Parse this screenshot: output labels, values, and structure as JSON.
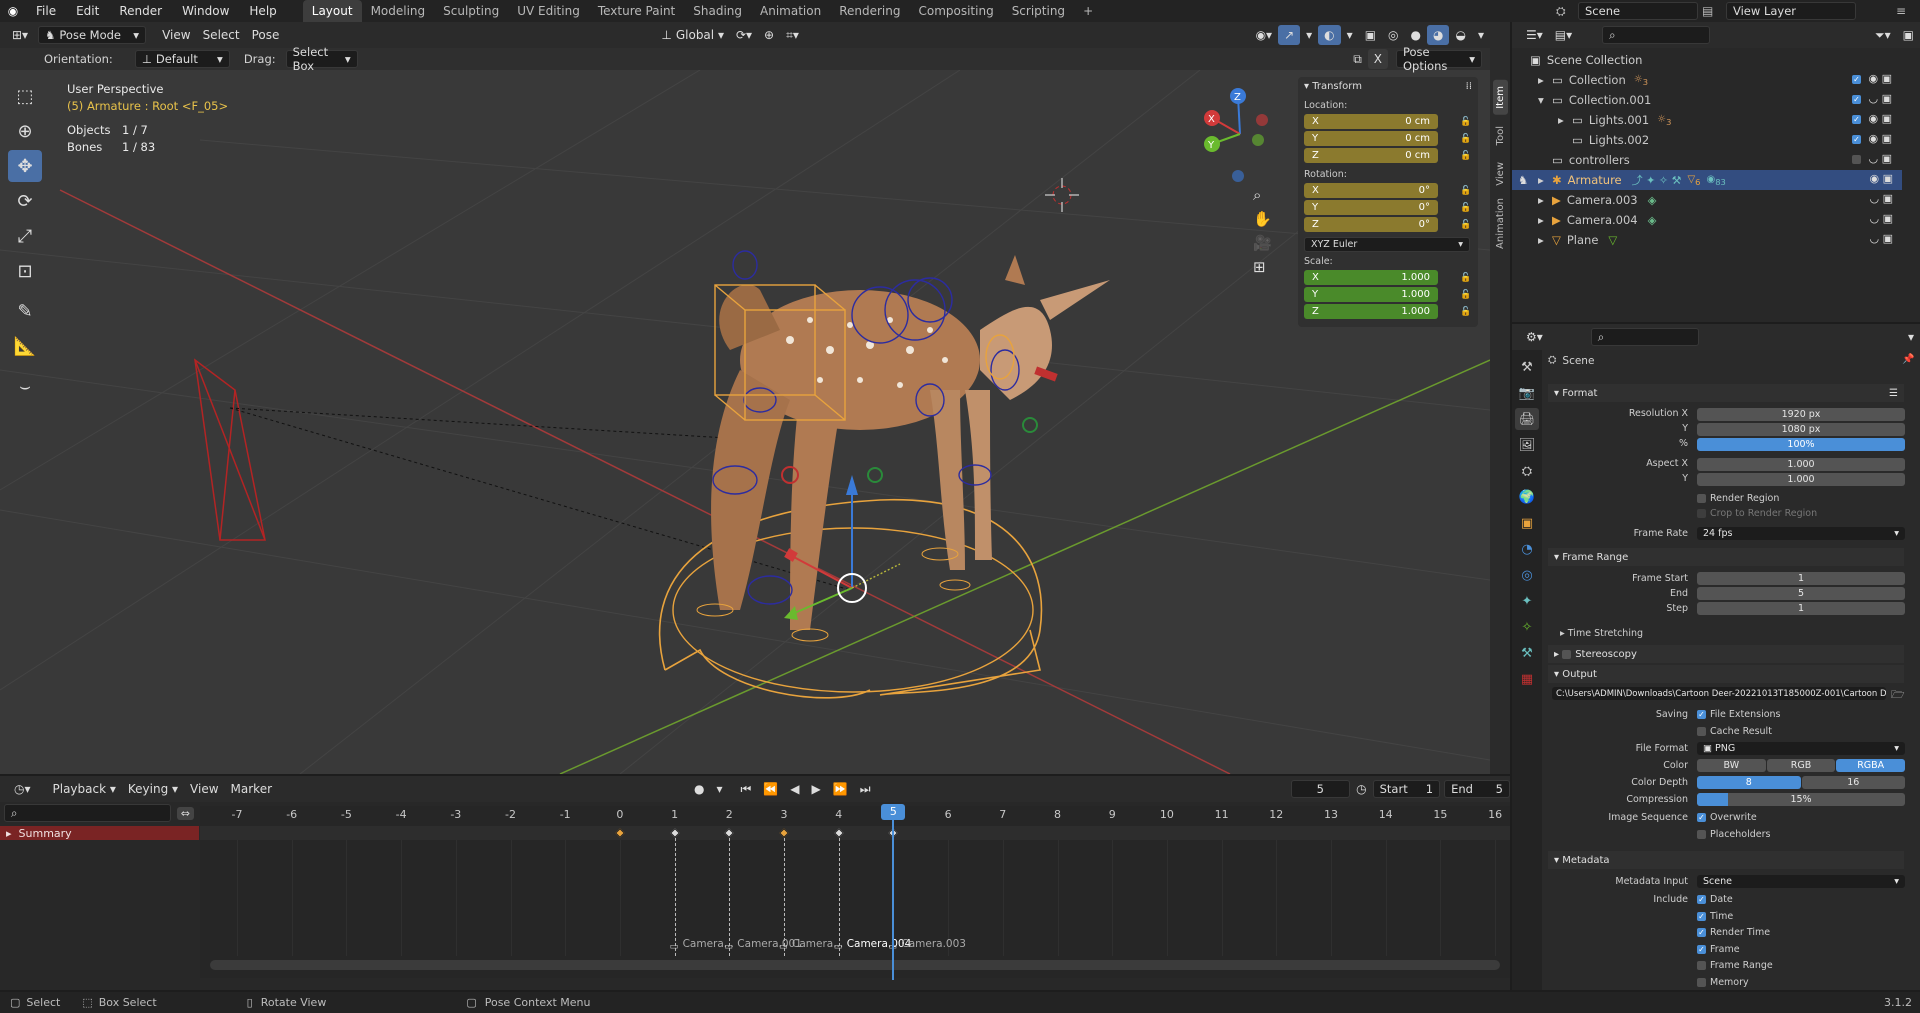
{
  "topbar": {
    "menus": [
      "File",
      "Edit",
      "Render",
      "Window",
      "Help"
    ],
    "workspaces": [
      "Layout",
      "Modeling",
      "Sculpting",
      "UV Editing",
      "Texture Paint",
      "Shading",
      "Animation",
      "Rendering",
      "Compositing",
      "Scripting"
    ],
    "active_workspace": "Layout",
    "scene": "Scene",
    "view_layer": "View Layer"
  },
  "viewport_header": {
    "mode": "Pose Mode",
    "menus": [
      "View",
      "Select",
      "Pose"
    ],
    "transform_orientation": "Global",
    "orientation_label": "Orientation:",
    "orientation_value": "Default",
    "drag_label": "Drag:",
    "drag_value": "Select Box",
    "pose_options": "Pose Options",
    "x_mirror": "X"
  },
  "viewport_info": {
    "perspective": "User Perspective",
    "context": "(5) Armature : Root <F_05>",
    "objects_label": "Objects",
    "objects_value": "1 / 7",
    "bones_label": "Bones",
    "bones_value": "1 / 83"
  },
  "gizmo": {
    "x": "X",
    "y": "Y",
    "z": "Z"
  },
  "npanel": {
    "title": "Transform",
    "location_label": "Location:",
    "location": [
      {
        "axis": "X",
        "value": "0 cm"
      },
      {
        "axis": "Y",
        "value": "0 cm"
      },
      {
        "axis": "Z",
        "value": "0 cm"
      }
    ],
    "rotation_label": "Rotation:",
    "rotation": [
      {
        "axis": "X",
        "value": "0°"
      },
      {
        "axis": "Y",
        "value": "0°"
      },
      {
        "axis": "Z",
        "value": "0°"
      }
    ],
    "rotation_mode": "XYZ Euler",
    "scale_label": "Scale:",
    "scale": [
      {
        "axis": "X",
        "value": "1.000"
      },
      {
        "axis": "Y",
        "value": "1.000"
      },
      {
        "axis": "Z",
        "value": "1.000"
      }
    ],
    "tabs": [
      "Item",
      "Tool",
      "View",
      "Animation"
    ]
  },
  "outliner": {
    "root": "Scene Collection",
    "items": [
      {
        "label": "Collection",
        "badge": "3"
      },
      {
        "label": "Collection.001",
        "badge": ""
      },
      {
        "label": "Lights.001",
        "badge": "3"
      },
      {
        "label": "Lights.002",
        "badge": ""
      },
      {
        "label": "controllers",
        "badge": ""
      },
      {
        "label": "Armature",
        "badge": "6"
      },
      {
        "label": "Camera.003",
        "badge": ""
      },
      {
        "label": "Camera.004",
        "badge": ""
      },
      {
        "label": "Plane",
        "badge": ""
      }
    ],
    "armature_bones_badge": "83"
  },
  "properties": {
    "context": "Scene",
    "format": {
      "title": "Format",
      "res_x_label": "Resolution X",
      "res_x": "1920 px",
      "res_y_label": "Y",
      "res_y": "1080 px",
      "pct_label": "%",
      "pct": "100%",
      "aspect_x_label": "Aspect X",
      "aspect_x": "1.000",
      "aspect_y_label": "Y",
      "aspect_y": "1.000",
      "render_region": "Render Region",
      "crop_region": "Crop to Render Region",
      "frame_rate_label": "Frame Rate",
      "frame_rate": "24 fps"
    },
    "frame_range": {
      "title": "Frame Range",
      "start_label": "Frame Start",
      "start": "1",
      "end_label": "End",
      "end": "5",
      "step_label": "Step",
      "step": "1"
    },
    "time_stretching": "Time Stretching",
    "stereoscopy": "Stereoscopy",
    "output": {
      "title": "Output",
      "path": "C:\\Users\\ADMIN\\Downloads\\Cartoon Deer-20221013T185000Z-001\\Cartoon Deer\\Re...",
      "saving_label": "Saving",
      "file_extensions": "File Extensions",
      "cache_result": "Cache Result",
      "file_format_label": "File Format",
      "file_format": "PNG",
      "color_label": "Color",
      "color_options": [
        "BW",
        "RGB",
        "RGBA"
      ],
      "color_selected": "RGBA",
      "depth_label": "Color Depth",
      "depth_options": [
        "8",
        "16"
      ],
      "depth_selected": "8",
      "compression_label": "Compression",
      "compression": "15%",
      "compression_fraction": 0.15,
      "image_sequence_label": "Image Sequence",
      "overwrite": "Overwrite",
      "placeholders": "Placeholders"
    },
    "metadata": {
      "title": "Metadata",
      "input_label": "Metadata Input",
      "input": "Scene",
      "include_label": "Include",
      "items": [
        {
          "label": "Date",
          "checked": true
        },
        {
          "label": "Time",
          "checked": true
        },
        {
          "label": "Render Time",
          "checked": true
        },
        {
          "label": "Frame",
          "checked": true
        },
        {
          "label": "Frame Range",
          "checked": false
        },
        {
          "label": "Memory",
          "checked": false
        }
      ]
    }
  },
  "timeline": {
    "menus": [
      "Playback",
      "Keying",
      "View",
      "Marker"
    ],
    "current_frame": "5",
    "start_label": "Start",
    "start": "1",
    "end_label": "End",
    "end": "5",
    "frame_numbers": [
      -7,
      -6,
      -5,
      -4,
      -3,
      -2,
      -1,
      0,
      1,
      2,
      3,
      4,
      5,
      6,
      7,
      8,
      9,
      10,
      11,
      12,
      13,
      14,
      15,
      16
    ],
    "summary": "Summary",
    "keyframes": [
      0,
      1,
      2,
      3,
      4,
      5
    ],
    "markers": [
      "Camera...",
      "Camera.001",
      "Camera...",
      "Camera.004",
      "Camera.003"
    ]
  },
  "statusbar": {
    "items": [
      "Select",
      "Box Select",
      "Rotate View",
      "Pose Context Menu"
    ],
    "version": "3.1.2"
  },
  "colors": {
    "accent": "#4a6fa5",
    "orange": "#e8a33d",
    "location": "#8b7a2e",
    "scale": "#4a8a2a"
  }
}
